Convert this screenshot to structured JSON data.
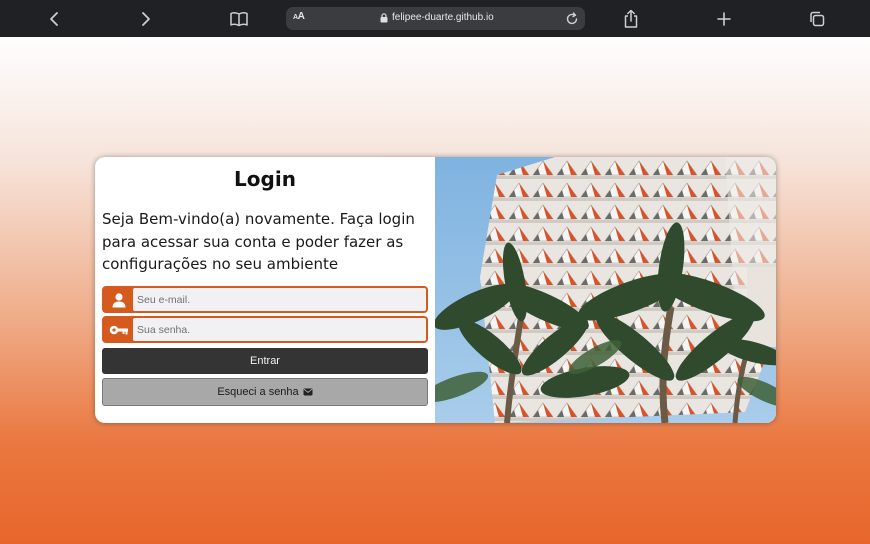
{
  "browser": {
    "text_size_label": "AA",
    "url": "felipee-duarte.github.io"
  },
  "login": {
    "title": "Login",
    "welcome": "Seja Bem-vindo(a) novamente. Faça login para acessar sua conta e poder fazer as configurações no seu ambiente",
    "email_placeholder": "Seu e-mail.",
    "password_placeholder": "Sua senha.",
    "enter_label": "Entrar",
    "forgot_label": "Esqueci a senha"
  },
  "colors": {
    "accent": "#d45a1e",
    "enter_button": "#343434",
    "forgot_button": "#a8a8a8",
    "toolbar": "#1f2124"
  }
}
